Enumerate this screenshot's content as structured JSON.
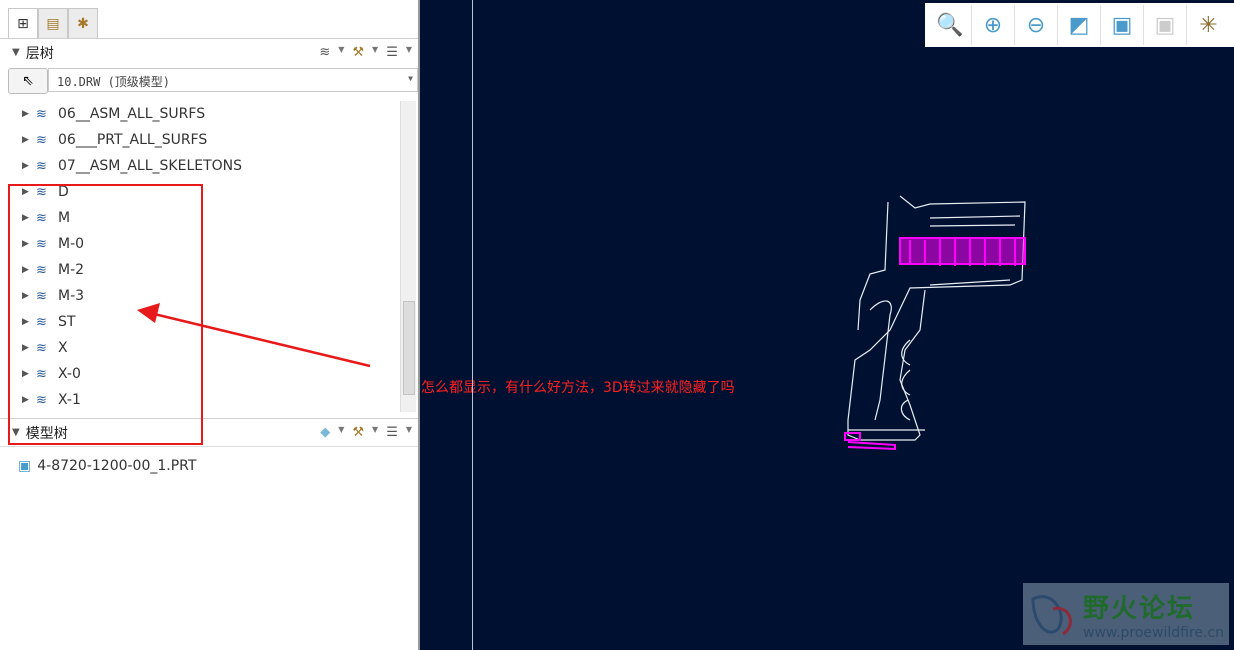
{
  "left_panel": {
    "layer_tree": {
      "title": "层树",
      "combo_value": "10.DRW (顶级模型)",
      "items": [
        "06__ASM_ALL_SURFS",
        "06___PRT_ALL_SURFS",
        "07__ASM_ALL_SKELETONS",
        "D",
        "M",
        "M-0",
        "M-2",
        "M-3",
        "ST",
        "X",
        "X-0",
        "X-1"
      ]
    },
    "model_tree": {
      "title": "模型树",
      "items": [
        "4-8720-1200-00_1.PRT"
      ]
    }
  },
  "annotation": {
    "text": "怎么都显示，有什么好方法，3D转过来就隐藏了吗",
    "color": "#e8191b"
  },
  "toolbar": {
    "icons": [
      "zoom-fit-icon",
      "zoom-in-icon",
      "zoom-out-icon",
      "view-refit-icon",
      "saved-views-icon",
      "display-style-icon",
      "datum-display-icon"
    ]
  },
  "watermark": {
    "title": "野火论坛",
    "url": "www.proewildfire.cn"
  },
  "colors": {
    "canvas": "#001030",
    "highlight": "#ff00ff"
  }
}
